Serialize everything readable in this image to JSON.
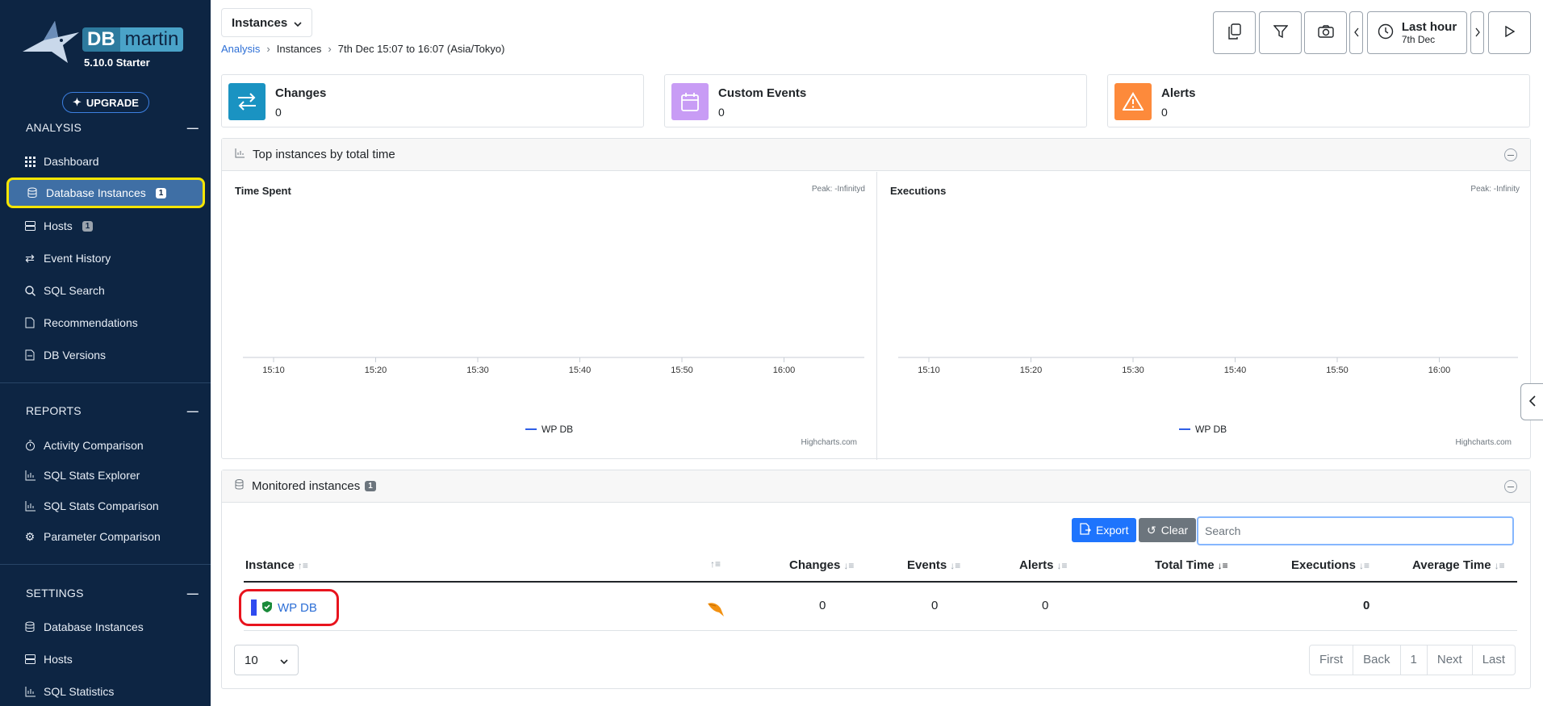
{
  "sidebar": {
    "logo": {
      "db": "DB",
      "rest": "martin",
      "version": "5.10.0 Starter"
    },
    "upgrade_label": "UPGRADE",
    "analysis": {
      "title": "ANALYSIS",
      "items": [
        {
          "label": "Dashboard",
          "icon": "grid-icon"
        },
        {
          "label": "Database Instances",
          "icon": "database-icon",
          "badge": "1",
          "active": true
        },
        {
          "label": "Hosts",
          "icon": "server-icon",
          "badge": "1"
        },
        {
          "label": "Event History",
          "icon": "arrows-icon"
        },
        {
          "label": "SQL Search",
          "icon": "search-icon"
        },
        {
          "label": "Recommendations",
          "icon": "document-icon"
        },
        {
          "label": "DB Versions",
          "icon": "file-icon"
        }
      ]
    },
    "reports": {
      "title": "REPORTS",
      "items": [
        {
          "label": "Activity Comparison",
          "icon": "stopwatch-icon"
        },
        {
          "label": "SQL Stats Explorer",
          "icon": "chart-icon"
        },
        {
          "label": "SQL Stats Comparison",
          "icon": "chart-icon"
        },
        {
          "label": "Parameter Comparison",
          "icon": "gear-icon"
        }
      ]
    },
    "settings": {
      "title": "SETTINGS",
      "items": [
        {
          "label": "Database Instances",
          "icon": "database-icon"
        },
        {
          "label": "Hosts",
          "icon": "server-icon"
        },
        {
          "label": "SQL Statistics",
          "icon": "chart-icon"
        }
      ]
    }
  },
  "header": {
    "dropdown_label": "Instances",
    "breadcrumb": [
      "Analysis",
      "Instances",
      "7th Dec 15:07 to 16:07 (Asia/Tokyo)"
    ],
    "time_range": {
      "label": "Last hour",
      "date": "7th Dec"
    }
  },
  "cards": [
    {
      "title": "Changes",
      "value": "0",
      "color": "#1a93c2",
      "icon": "swap-icon"
    },
    {
      "title": "Custom Events",
      "value": "0",
      "color": "#c89cf5",
      "icon": "calendar-icon"
    },
    {
      "title": "Alerts",
      "value": "0",
      "color": "#fd8a3b",
      "icon": "warning-icon"
    }
  ],
  "top_panel": {
    "title": "Top instances by total time"
  },
  "chart_data": [
    {
      "type": "line",
      "title": "Time Spent",
      "peak_text": "Peak: -Infinityd",
      "x": [
        "15:10",
        "15:20",
        "15:30",
        "15:40",
        "15:50",
        "16:00"
      ],
      "series": [
        {
          "name": "WP DB",
          "values": []
        }
      ],
      "credit": "Highcharts.com"
    },
    {
      "type": "line",
      "title": "Executions",
      "peak_text": "Peak: -Infinity",
      "x": [
        "15:10",
        "15:20",
        "15:30",
        "15:40",
        "15:50",
        "16:00"
      ],
      "series": [
        {
          "name": "WP DB",
          "values": []
        }
      ],
      "credit": "Highcharts.com"
    }
  ],
  "monitored_panel": {
    "title": "Monitored instances",
    "badge": "1"
  },
  "table": {
    "export_label": "Export",
    "clear_label": "Clear",
    "search_placeholder": "Search",
    "columns": [
      "Instance",
      "Changes",
      "Events",
      "Alerts",
      "Total Time",
      "Executions",
      "Average Time"
    ],
    "rows": [
      {
        "instance": "WP DB",
        "changes": "0",
        "events": "0",
        "alerts": "0",
        "total_time": "",
        "executions": "0",
        "average_time": ""
      }
    ],
    "page_size": "10",
    "pager": [
      "First",
      "Back",
      "1",
      "Next",
      "Last"
    ]
  },
  "colors": {
    "sidebar_bg": "#0d2543",
    "accent": "#1e74fd",
    "series": "#2f5ee6",
    "highlight": "#f5e600",
    "mark": "#e8141e"
  }
}
